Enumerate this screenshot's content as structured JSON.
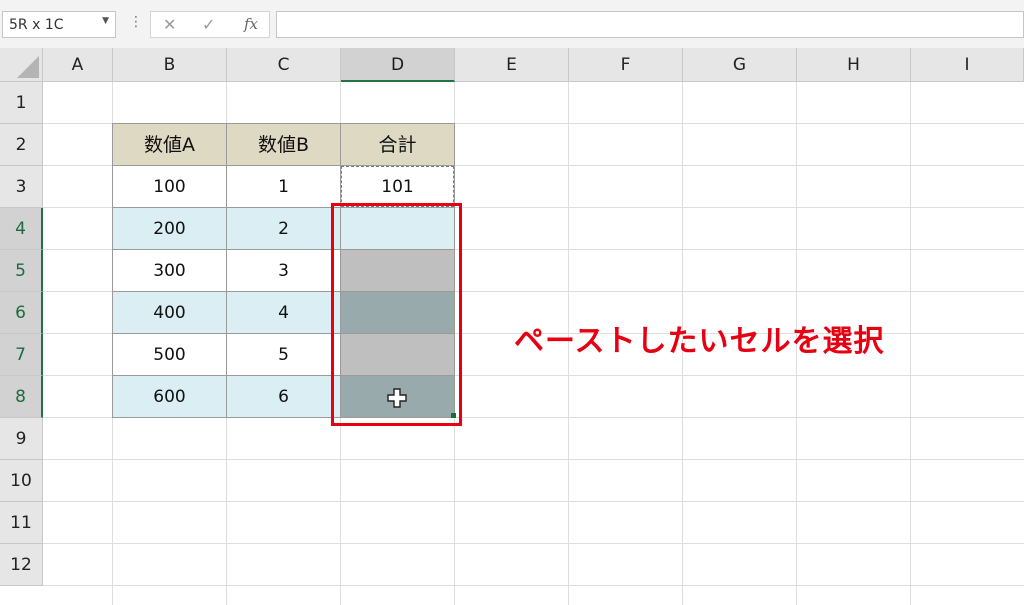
{
  "formula_bar": {
    "name_box": "5R x 1C",
    "dots": "⋮",
    "cancel_icon": "✕",
    "enter_icon": "✓",
    "fx_label": "fx",
    "formula": ""
  },
  "columns": [
    "A",
    "B",
    "C",
    "D",
    "E",
    "F",
    "G",
    "H",
    "I"
  ],
  "rows": [
    "1",
    "2",
    "3",
    "4",
    "5",
    "6",
    "7",
    "8",
    "9",
    "10",
    "11",
    "12"
  ],
  "selected_column": "D",
  "selected_rows": [
    "4",
    "5",
    "6",
    "7",
    "8"
  ],
  "table": {
    "headers": [
      "数値A",
      "数値B",
      "合計"
    ],
    "data": [
      {
        "a": "100",
        "b": "1",
        "sum": "101"
      },
      {
        "a": "200",
        "b": "2",
        "sum": ""
      },
      {
        "a": "300",
        "b": "3",
        "sum": ""
      },
      {
        "a": "400",
        "b": "4",
        "sum": ""
      },
      {
        "a": "500",
        "b": "5",
        "sum": ""
      },
      {
        "a": "600",
        "b": "6",
        "sum": ""
      }
    ]
  },
  "annotation": "ペーストしたいセルを選択",
  "colors": {
    "header_fill": "#ddd9c3",
    "row_fill": "#daeef3",
    "highlight": "#e60012",
    "excel_green": "#217346"
  }
}
